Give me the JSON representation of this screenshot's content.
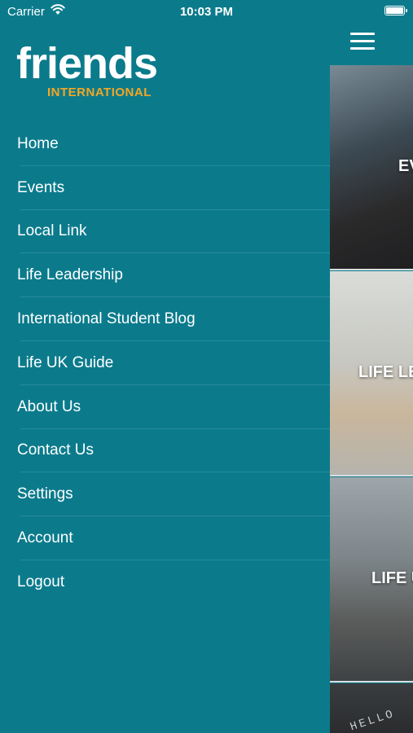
{
  "status": {
    "carrier": "Carrier",
    "time": "10:03 PM"
  },
  "logo": {
    "word": "friends",
    "sub": "INTERNATIONAL"
  },
  "menu": [
    {
      "label": "Home"
    },
    {
      "label": "Events"
    },
    {
      "label": "Local Link"
    },
    {
      "label": "Life Leadership"
    },
    {
      "label": "International Student Blog"
    },
    {
      "label": "Life UK Guide"
    },
    {
      "label": "About Us"
    },
    {
      "label": "Contact Us"
    },
    {
      "label": "Settings"
    },
    {
      "label": "Account"
    },
    {
      "label": "Logout"
    }
  ],
  "cards": [
    {
      "title": "EV"
    },
    {
      "title": "LIFE LE"
    },
    {
      "title": "LIFE U"
    },
    {
      "title": "HELLO"
    }
  ],
  "colors": {
    "background": "#0b7b8c",
    "accent": "#f4a623",
    "text": "#ffffff"
  }
}
